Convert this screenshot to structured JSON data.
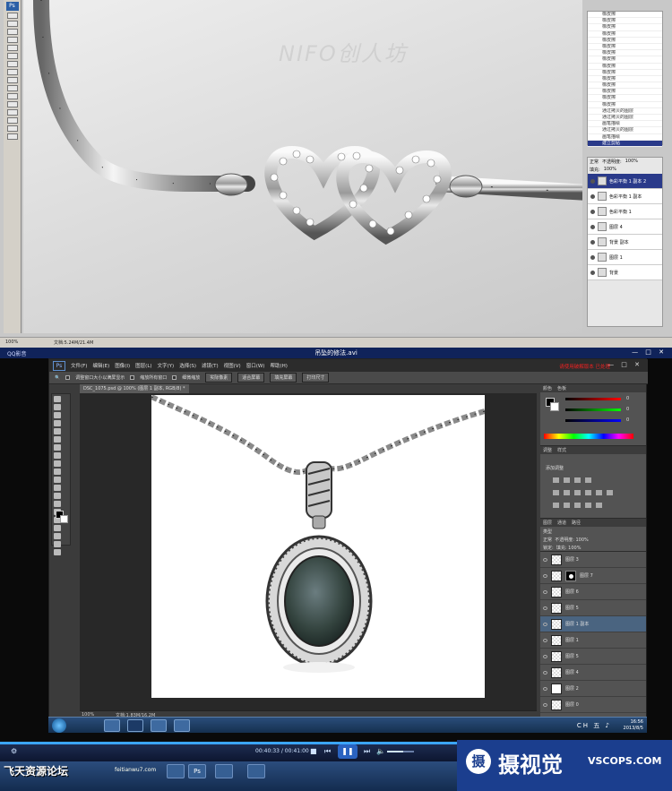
{
  "top_window": {
    "status_zoom": "100%",
    "status_doc": "文档:5.24M/21.4M",
    "watermark": "NIFO创人坊",
    "history_rows": [
      "橡皮擦",
      "橡皮擦",
      "橡皮擦",
      "橡皮擦",
      "橡皮擦",
      "橡皮擦",
      "橡皮擦",
      "橡皮擦",
      "橡皮擦",
      "橡皮擦",
      "橡皮擦",
      "橡皮擦",
      "橡皮擦",
      "橡皮擦",
      "橡皮擦",
      "通过拷贝的图层",
      "通过拷贝的图层",
      "画笔描绘",
      "通过拷贝的图层",
      "画笔描绘",
      "建立剪贴"
    ],
    "history_selected": 20,
    "layers_mode": "正常",
    "layers_opacity_label": "不透明度:",
    "layers_opacity": "100%",
    "layers_fill_label": "填充:",
    "layers_fill": "100%",
    "layers": [
      {
        "name": "色彩平衡 1 副本 2",
        "selected": true
      },
      {
        "name": "色彩平衡 1 副本",
        "selected": false
      },
      {
        "name": "色彩平衡 1",
        "selected": false
      },
      {
        "name": "图层 4",
        "selected": false
      },
      {
        "name": "背景 副本",
        "selected": false
      },
      {
        "name": "图层 1",
        "selected": false
      },
      {
        "name": "背景",
        "selected": false
      }
    ]
  },
  "player": {
    "app_name": "QQ影音",
    "title": "吊坠的修法.avi",
    "window_controls": "— □ ✕",
    "current_time": "00:40:33",
    "total_time": "00:41:00",
    "progress": 0.989,
    "volume": 0.6,
    "controls": {
      "stop": "■",
      "prev": "⏮",
      "play": "❚❚",
      "next": "⏭",
      "mute": "🔈"
    }
  },
  "cs6": {
    "logo": "Ps",
    "menu": [
      "文件(F)",
      "编辑(E)",
      "图像(I)",
      "图层(L)",
      "文字(Y)",
      "选择(S)",
      "滤镜(T)",
      "视图(V)",
      "窗口(W)",
      "帮助(H)"
    ],
    "red_note": "请使用破解版本 已处理",
    "options": {
      "check1": "调整窗口大小以满屏显示",
      "check2": "缩放所有窗口",
      "scrub": "细微缩放",
      "btn_actual": "实际像素",
      "btn_fit": "适合屏幕",
      "btn_fill": "填充屏幕",
      "btn_print": "打印尺寸"
    },
    "doc_tab": "DSC_1075.psd @ 100% (图层 1 副本, RGB/8) *",
    "status_zoom": "100%",
    "status_doc": "文档:1.83M/16.2M",
    "panel_tabs_color": [
      "颜色",
      "色板"
    ],
    "panel_tabs_adj": [
      "调整",
      "样式"
    ],
    "adj_label": "添加调整",
    "panel_tabs_layers": [
      "图层",
      "通道",
      "路径"
    ],
    "kind_label": "类型",
    "blend_mode": "正常",
    "opacity_label": "不透明度:",
    "opacity": "100%",
    "lock_label": "锁定:",
    "fill_label": "填充:",
    "fill": "100%",
    "color_values": [
      "0",
      "0",
      "0"
    ],
    "layers": [
      {
        "name": "图层 3",
        "thumb": "checker",
        "mask": false,
        "selected": false
      },
      {
        "name": "图层 7",
        "thumb": "checker",
        "mask": true,
        "selected": false
      },
      {
        "name": "图层 6",
        "thumb": "checker",
        "mask": false,
        "selected": false
      },
      {
        "name": "图层 5",
        "thumb": "checker",
        "mask": false,
        "selected": false
      },
      {
        "name": "图层 1 副本",
        "thumb": "checker",
        "mask": false,
        "selected": true
      },
      {
        "name": "图层 1",
        "thumb": "checker",
        "mask": false,
        "selected": false
      },
      {
        "name": "图层 5",
        "thumb": "checker",
        "mask": false,
        "selected": false
      },
      {
        "name": "图层 4",
        "thumb": "checker",
        "mask": false,
        "selected": false
      },
      {
        "name": "图层 2",
        "thumb": "white",
        "mask": false,
        "selected": false
      },
      {
        "name": "图层 0",
        "thumb": "checker",
        "mask": false,
        "selected": false
      }
    ]
  },
  "win_taskbar": {
    "clock_time": "16:56",
    "clock_date": "2013/8/5",
    "tray": "CH 五 ♪"
  },
  "host_taskbar": {
    "forum": "飞天资源论坛",
    "forum_url": "feitianwu7.com",
    "ps_label": "Ps"
  },
  "brand": {
    "logo_char": "摄",
    "cn": "摄视觉",
    "en": "VSCOPS.COM"
  },
  "colors": {
    "ps_dark": "#3b3b3b",
    "selection_blue": "#4a6480",
    "player_bar": "#10235a",
    "brand_blue": "#1b3e8e",
    "red_note": "#e22222"
  }
}
